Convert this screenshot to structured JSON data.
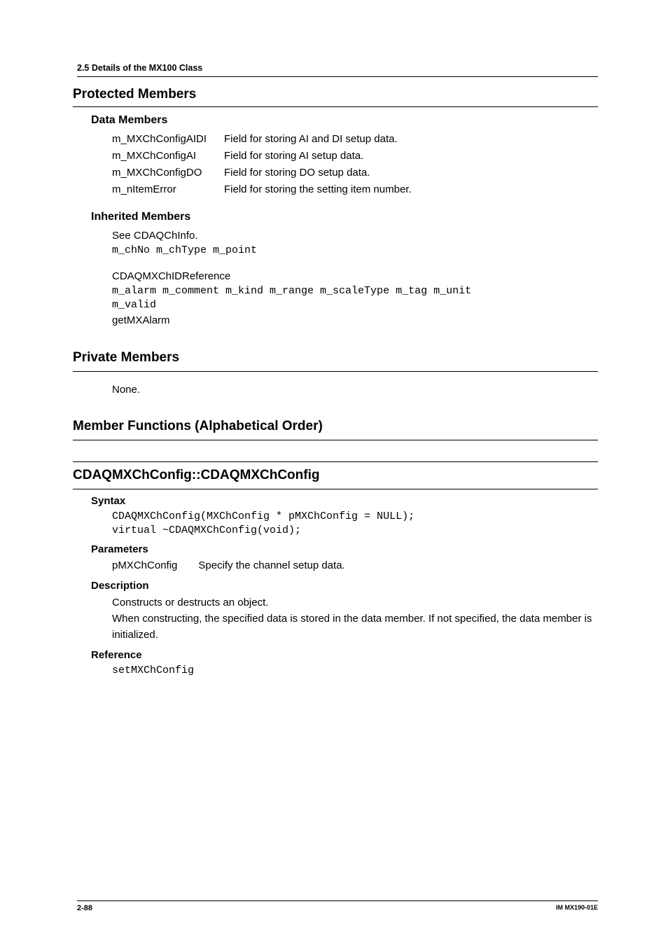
{
  "pageHeader": "2.5  Details of the MX100 Class",
  "sections": {
    "protectedMembers": {
      "title": "Protected Members",
      "dataMembers": {
        "title": "Data Members",
        "rows": [
          {
            "name": "m_MXChConfigAIDI",
            "desc": "Field for storing AI and DI setup data."
          },
          {
            "name": "m_MXChConfigAI",
            "desc": "Field for storing AI setup data."
          },
          {
            "name": "m_MXChConfigDO",
            "desc": "Field for storing DO setup data."
          },
          {
            "name": "m_nItemError",
            "desc": "Field for storing the setting item number."
          }
        ]
      },
      "inheritedMembers": {
        "title": "Inherited Members",
        "line1": "See CDAQChInfo.",
        "code1": "m_chNo m_chType m_point",
        "line2": "CDAQMXChIDReference",
        "code2": "m_alarm m_comment m_kind m_range m_scaleType m_tag m_unit\nm_valid",
        "line3": "getMXAlarm"
      }
    },
    "privateMembers": {
      "title": "Private Members",
      "body": "None."
    },
    "memberFunctions": {
      "title": "Member Functions (Alphabetical Order)"
    },
    "classRef": {
      "title": "CDAQMXChConfig::CDAQMXChConfig",
      "syntax": {
        "title": "Syntax",
        "code": "CDAQMXChConfig(MXChConfig * pMXChConfig = NULL);\nvirtual ~CDAQMXChConfig(void);"
      },
      "parameters": {
        "title": "Parameters",
        "rows": [
          {
            "name": "pMXChConfig",
            "desc": "Specify the channel setup data."
          }
        ]
      },
      "description": {
        "title": "Description",
        "line1": "Constructs or destructs an object.",
        "line2": "When constructing, the specified data is stored in the data member. If not specified, the data member is initialized."
      },
      "reference": {
        "title": "Reference",
        "code": "setMXChConfig"
      }
    }
  },
  "footer": {
    "left": "2-88",
    "right": "IM MX190-01E"
  }
}
